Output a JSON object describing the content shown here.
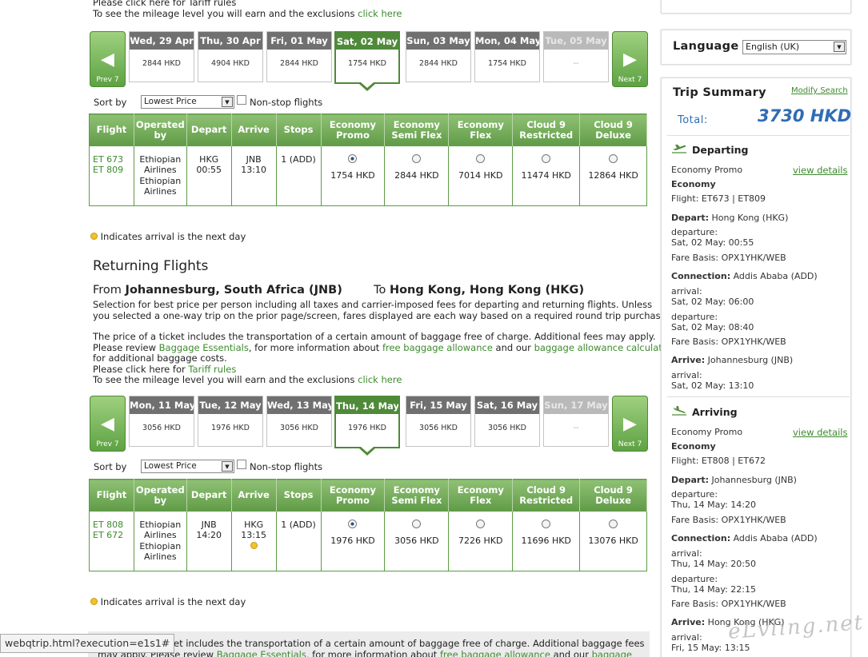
{
  "outbound": {
    "top_text1": "Please click here for Tariff rules",
    "top_text2_pre": "To see the mileage level you will earn and the exclusions ",
    "top_text2_link": "click here",
    "prev_label": "Prev 7",
    "next_label": "Next 7",
    "dates": [
      {
        "day": "Wed, 29 Apr",
        "price": "2844 HKD"
      },
      {
        "day": "Thu, 30 Apr",
        "price": "4904 HKD"
      },
      {
        "day": "Fri, 01 May",
        "price": "2844 HKD"
      },
      {
        "day": "Sat, 02 May",
        "price": "1754 HKD"
      },
      {
        "day": "Sun, 03 May",
        "price": "2844 HKD"
      },
      {
        "day": "Mon, 04 May",
        "price": "1754 HKD"
      },
      {
        "day": "Tue, 05 May",
        "price": "--"
      }
    ],
    "row": {
      "flight1": "ET 673",
      "flight2": "ET 809",
      "op1": "Ethiopian",
      "op2": "Airlines",
      "op3": "Ethiopian",
      "op4": "Airlines",
      "dep_code": "HKG",
      "dep_time": "00:55",
      "arr_code": "JNB",
      "arr_time": "13:10",
      "stops": "1 (ADD)",
      "prices": [
        "1754 HKD",
        "2844 HKD",
        "7014 HKD",
        "11474 HKD",
        "12864 HKD"
      ]
    },
    "next_day_note": "Indicates arrival is the next day"
  },
  "sort": {
    "label": "Sort by",
    "value": "Lowest Price",
    "nonstop": "Non-stop flights"
  },
  "table_headers": {
    "flight": "Flight",
    "op_a": "Operated",
    "op_b": "by",
    "depart": "Depart",
    "arrive": "Arrive",
    "stops": "Stops",
    "c1a": "Economy",
    "c1b": "Promo",
    "c2a": "Economy",
    "c2b": "Semi Flex",
    "c3a": "Economy",
    "c3b": "Flex",
    "c4a": "Cloud 9",
    "c4b": "Restricted",
    "c5a": "Cloud 9",
    "c5b": "Deluxe"
  },
  "returning": {
    "heading": "Returning Flights",
    "from_label": "From ",
    "from_city": "Johannesburg, South Africa (JNB)",
    "to_label": "To ",
    "to_city": "Hong Kong, Hong Kong (HKG)",
    "p1": "Selection for best price per person including all taxes and carrier-imposed fees for departing and returning flights. Unless",
    "p2": "you selected a one-way trip on the prior page/screen, fares displayed are each way based on a required round trip purchase.",
    "p3": "The price of a ticket includes the transportation of a certain amount of baggage free of charge. Additional fees may apply.",
    "p4_pre": "Please review ",
    "p4_l1": "Baggage Essentials",
    "p4_mid": ", for more information about ",
    "p4_l2": "free baggage allowance",
    "p4_and": " and our ",
    "p4_l3": "baggage allowance calculator",
    "p5": "for additional baggage costs.",
    "p6_pre": "Please click here for ",
    "p6_link": "Tariff rules",
    "p7_pre": "To see the mileage level you will earn and the exclusions ",
    "p7_link": "click here",
    "dates": [
      {
        "day": "Mon, 11 May",
        "price": "3056 HKD"
      },
      {
        "day": "Tue, 12 May",
        "price": "1976 HKD"
      },
      {
        "day": "Wed, 13 May",
        "price": "3056 HKD"
      },
      {
        "day": "Thu, 14 May",
        "price": "1976 HKD"
      },
      {
        "day": "Fri, 15 May",
        "price": "3056 HKD"
      },
      {
        "day": "Sat, 16 May",
        "price": "3056 HKD"
      },
      {
        "day": "Sun, 17 May",
        "price": "--"
      }
    ],
    "row": {
      "flight1": "ET 808",
      "flight2": "ET 672",
      "op1": "Ethiopian",
      "op2": "Airlines",
      "op3": "Ethiopian",
      "op4": "Airlines",
      "dep_code": "JNB",
      "dep_time": "14:20",
      "arr_code": "HKG",
      "arr_time": "13:15",
      "stops": "1 (ADD)",
      "prices": [
        "1976 HKD",
        "3056 HKD",
        "7226 HKD",
        "11696 HKD",
        "13076 HKD"
      ]
    },
    "next_day_note": "Indicates arrival is the next day",
    "bottom1": "et includes the transportation of a certain amount of baggage free of charge. Additional baggage fees",
    "bottom2_pre": "may apply. Please review ",
    "bottom2_l1": "Baggage Essentials",
    "bottom2_mid": ", for more information about ",
    "bottom2_l2": "free baggage allowance",
    "bottom2_and": " and our ",
    "bottom2_l3": "baggage"
  },
  "status_bar": "webqtrip.html?execution=e1s1#",
  "language": {
    "label": "Language",
    "value": "English (UK)"
  },
  "summary": {
    "title": "Trip Summary",
    "modify": "Modify Search",
    "total_label": "Total:",
    "total_value": "3730 HKD",
    "departing": {
      "title": "Departing",
      "fare": "Economy Promo",
      "view": "view details",
      "cabin": "Economy",
      "flight": "Flight: ET673 | ET809",
      "depart_label": "Depart:",
      "depart_val": " Hong Kong (HKG)",
      "dep1": "departure:",
      "dep1v": "Sat, 02 May: 00:55",
      "fb1": "Fare Basis: OPX1YHK/WEB",
      "conn_label": "Connection:",
      "conn_val": " Addis Ababa (ADD)",
      "arr1": "arrival:",
      "arr1v": "Sat, 02 May: 06:00",
      "dep2": "departure:",
      "dep2v": "Sat, 02 May: 08:40",
      "fb2": "Fare Basis: OPX1YHK/WEB",
      "arrive_label": "Arrive:",
      "arrive_val": " Johannesburg (JNB)",
      "arr2": "arrival:",
      "arr2v": "Sat, 02 May: 13:10"
    },
    "arriving": {
      "title": "Arriving",
      "fare": "Economy Promo",
      "view": "view details",
      "cabin": "Economy",
      "flight": "Flight: ET808 | ET672",
      "depart_label": "Depart:",
      "depart_val": " Johannesburg (JNB)",
      "dep1": "departure:",
      "dep1v": "Thu, 14 May: 14:20",
      "fb1": "Fare Basis: OPX1YHK/WEB",
      "conn_label": "Connection:",
      "conn_val": " Addis Ababa (ADD)",
      "arr1": "arrival:",
      "arr1v": "Thu, 14 May: 20:50",
      "dep2": "departure:",
      "dep2v": "Thu, 14 May: 22:15",
      "fb2": "Fare Basis: OPX1YHK/WEB",
      "arrive_label": "Arrive:",
      "arrive_val": " Hong Kong (HKG)",
      "arr2": "arrival:",
      "arr2v": "Fri, 15 May: 13:15"
    }
  },
  "watermark": "eLvling.net",
  "colors": {
    "green": "#4f8a39",
    "link": "#3d8a2e",
    "total": "#2f6db5"
  }
}
